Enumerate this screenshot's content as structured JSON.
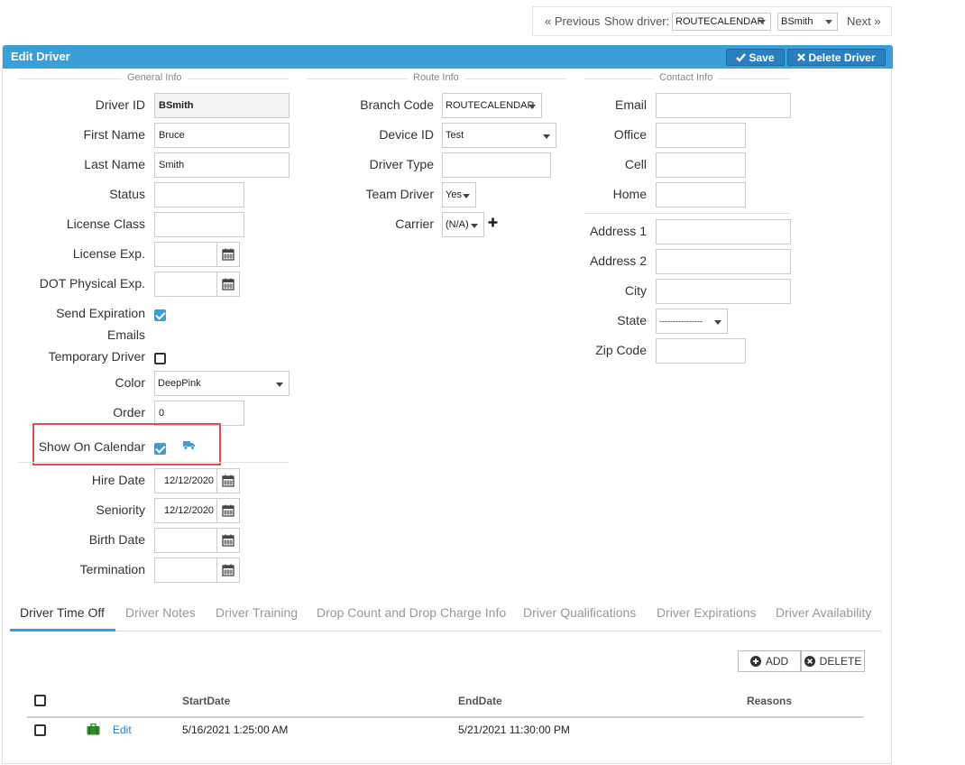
{
  "topnav": {
    "previous": "« Previous",
    "show_driver_label": "Show driver:",
    "branch_select": "ROUTECALENDAR",
    "driver_select": "BSmith",
    "next": "Next »"
  },
  "panel": {
    "title": "Edit Driver",
    "save": "Save",
    "delete_driver": "Delete Driver"
  },
  "sections": {
    "general": "General Info",
    "route": "Route Info",
    "contact": "Contact Info"
  },
  "general": {
    "driver_id_label": "Driver ID",
    "driver_id_value": "BSmith",
    "first_name_label": "First Name",
    "first_name_value": "Bruce",
    "last_name_label": "Last Name",
    "last_name_value": "Smith",
    "status_label": "Status",
    "status_value": "",
    "license_class_label": "License Class",
    "license_class_value": "",
    "license_exp_label": "License Exp.",
    "license_exp_value": "",
    "dot_label": "DOT Physical Exp.",
    "dot_value": "",
    "send_exp_label_1": "Send Expiration",
    "send_exp_label_2": "Emails",
    "send_exp_checked": true,
    "temp_driver_label": "Temporary Driver",
    "temp_driver_checked": false,
    "color_label": "Color",
    "color_value": "DeepPink",
    "order_label": "Order",
    "order_value": "0",
    "show_on_calendar_label": "Show On Calendar",
    "show_on_calendar_checked": true,
    "truck_icon_color": "#3a9fd8",
    "hire_date_label": "Hire Date",
    "hire_date_value": "12/12/2020",
    "seniority_label": "Seniority",
    "seniority_value": "12/12/2020",
    "birth_date_label": "Birth Date",
    "birth_date_value": "",
    "termination_label": "Termination",
    "termination_value": ""
  },
  "route": {
    "branch_code_label": "Branch Code",
    "branch_code_value": "ROUTECALENDAR",
    "device_id_label": "Device ID",
    "device_id_value": "Test",
    "driver_type_label": "Driver Type",
    "driver_type_value": "",
    "team_driver_label": "Team Driver",
    "team_driver_value": "Yes",
    "carrier_label": "Carrier",
    "carrier_value": "(N/A)"
  },
  "contact": {
    "email_label": "Email",
    "email_value": "",
    "office_label": "Office",
    "office_value": "",
    "cell_label": "Cell",
    "cell_value": "",
    "home_label": "Home",
    "home_value": "",
    "address1_label": "Address 1",
    "address1_value": "",
    "address2_label": "Address 2",
    "address2_value": "",
    "city_label": "City",
    "city_value": "",
    "state_label": "State",
    "state_value": "----------------",
    "zip_label": "Zip Code",
    "zip_value": ""
  },
  "tabs": [
    {
      "label": "Driver Time Off",
      "active": true
    },
    {
      "label": "Driver Notes",
      "active": false
    },
    {
      "label": "Driver Training",
      "active": false
    },
    {
      "label": "Drop Count and Drop Charge Info",
      "active": false
    },
    {
      "label": "Driver Qualifications",
      "active": false
    },
    {
      "label": "Driver Expirations",
      "active": false
    },
    {
      "label": "Driver Availability",
      "active": false
    }
  ],
  "grid": {
    "add": "ADD",
    "delete": "DELETE",
    "headers": {
      "start": "StartDate",
      "end": "EndDate",
      "reasons": "Reasons"
    },
    "rows": [
      {
        "edit": "Edit",
        "start": "5/16/2021 1:25:00 AM",
        "end": "5/21/2021 11:30:00 PM",
        "reasons": ""
      }
    ]
  },
  "colors": {
    "header_blue": "#3a9fd8",
    "highlight_red": "#e05050",
    "briefcase_green": "#2e8b2e",
    "link_blue": "#2a7fc0"
  }
}
